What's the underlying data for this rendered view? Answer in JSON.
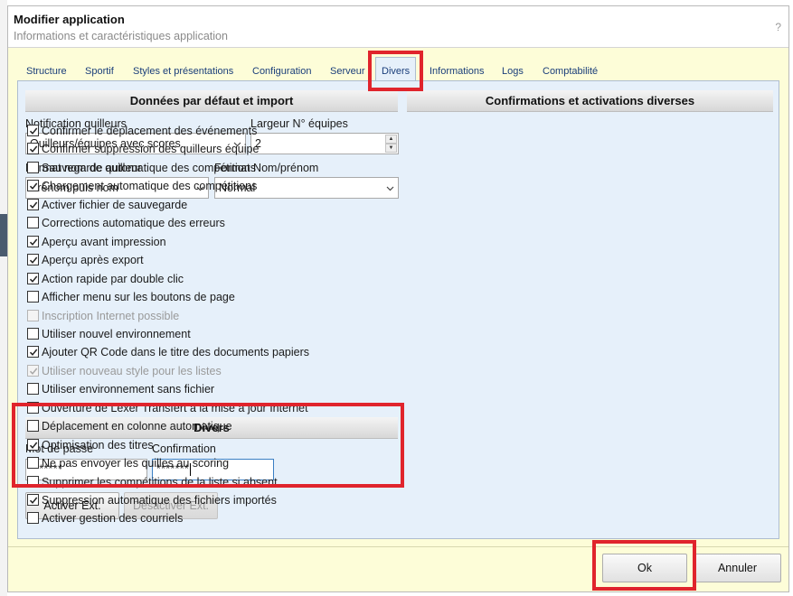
{
  "dialog": {
    "title": "Modifier application",
    "subtitle": "Informations et caractéristiques application",
    "help": "?"
  },
  "tabs": [
    {
      "label": "Structure"
    },
    {
      "label": "Sportif"
    },
    {
      "label": "Styles et présentations"
    },
    {
      "label": "Configuration"
    },
    {
      "label": "Serveur"
    },
    {
      "label": "Divers"
    },
    {
      "label": "Informations"
    },
    {
      "label": "Logs"
    },
    {
      "label": "Comptabilité"
    }
  ],
  "active_tab": "Divers",
  "defaults": {
    "heading": "Données par défaut et import",
    "notification_label": "Notification quilleurs",
    "notification_value": "Quilleurs/équipes avec scores",
    "width_label": "Largeur N° équipes",
    "width_value": "2",
    "name_format_label": "Format nom de quilleur",
    "name_format_value": "Prénom puis nom",
    "lastfirst_label": "Format Nom/prénom",
    "lastfirst_value": "Normal"
  },
  "misc": {
    "heading": "Divers",
    "password_label": "Mot de passe",
    "password_value": "*******",
    "confirm_label": "Confirmation",
    "confirm_value": "*******",
    "activate_label": "Activer Ext.",
    "deactivate_label": "Désactiver Ext."
  },
  "confirmations": {
    "heading": "Confirmations et activations diverses",
    "items": [
      {
        "label": "Confirmer le déplacement des événements",
        "checked": true,
        "disabled": false
      },
      {
        "label": "Confirmer suppression des quilleurs équipe",
        "checked": true,
        "disabled": false
      },
      {
        "label": "Sauvegarde automatique des compétitions",
        "checked": false,
        "disabled": false
      },
      {
        "label": "Chargement automatique des compétitions",
        "checked": true,
        "disabled": false
      },
      {
        "label": "Activer fichier de sauvegarde",
        "checked": true,
        "disabled": false
      },
      {
        "label": "Corrections automatique des erreurs",
        "checked": false,
        "disabled": false
      },
      {
        "label": "Aperçu avant impression",
        "checked": true,
        "disabled": false
      },
      {
        "label": "Aperçu après export",
        "checked": true,
        "disabled": false
      },
      {
        "label": "Action rapide par double clic",
        "checked": true,
        "disabled": false
      },
      {
        "label": "Afficher menu sur les boutons de page",
        "checked": false,
        "disabled": false
      },
      {
        "label": "Inscription Internet possible",
        "checked": false,
        "disabled": true
      },
      {
        "label": "Utiliser nouvel environnement",
        "checked": false,
        "disabled": false
      },
      {
        "label": "Ajouter QR Code dans le titre des documents papiers",
        "checked": true,
        "disabled": false
      },
      {
        "label": "Utiliser nouveau style pour les listes",
        "checked": true,
        "disabled": true
      },
      {
        "label": "Utiliser environnement sans fichier",
        "checked": false,
        "disabled": false
      },
      {
        "label": "Ouverture de Lexer Transfert à la mise à jour Internet",
        "checked": false,
        "disabled": false
      },
      {
        "label": "Déplacement en colonne automatique",
        "checked": false,
        "disabled": false
      },
      {
        "label": "Optimisation des titres",
        "checked": true,
        "disabled": false
      },
      {
        "label": "Ne pas envoyer les quilles au scoring",
        "checked": false,
        "disabled": false
      },
      {
        "label": "Supprimer les compétitions de la liste si absent",
        "checked": false,
        "disabled": false
      },
      {
        "label": "Suppression automatique des fichiers importés",
        "checked": true,
        "disabled": false
      },
      {
        "label": "Activer gestion des courriels",
        "checked": false,
        "disabled": false
      }
    ]
  },
  "footer": {
    "ok_label": "Ok",
    "cancel_label": "Annuler"
  },
  "colors": {
    "highlight": "#e0242c",
    "dialog_bg": "#fdfdd8",
    "panel_bg": "#e6f0fa",
    "tab_text": "#1a3e7a"
  },
  "icons": [
    "chevron-down-icon",
    "spin-up-icon",
    "spin-down-icon",
    "checkmark-icon",
    "help-icon"
  ]
}
